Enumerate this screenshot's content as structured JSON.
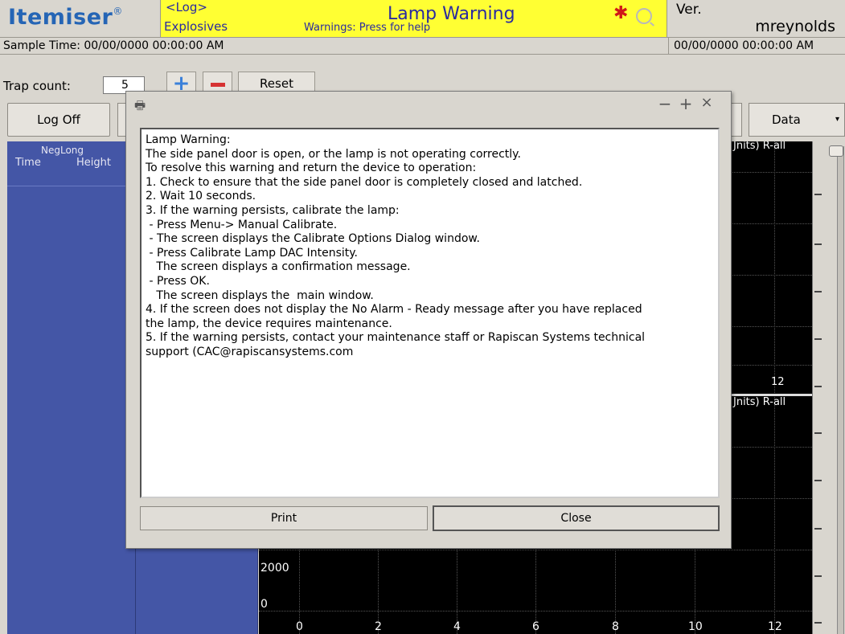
{
  "header": {
    "logo_text": "Itemiser",
    "logo_mark": "®",
    "banner_log": "<Log>",
    "banner_category": "Explosives",
    "banner_title": "Lamp Warning",
    "banner_hint": "Warnings: Press for help",
    "alarm_icon": "asterisk-icon",
    "ver_label": "Ver.",
    "username": "mreynolds",
    "colors": {
      "banner_bg": "#ffff33",
      "banner_text": "#2a2aa0",
      "logo": "#2565b5",
      "alarm": "#d01818",
      "panel": "#4456a6"
    }
  },
  "status": {
    "sample_time": "Sample Time: 00/00/0000  00:00:00 AM",
    "right_time": "00/00/0000  00:00:00 AM"
  },
  "controls": {
    "trap_label": "Trap count:",
    "trap_value": "5",
    "plus_label": "+",
    "reset_label": "Reset",
    "logoff_label": "Log Off",
    "data_label": "Data",
    "data_dropdown": "▾"
  },
  "table": {
    "group_header": "NegLong",
    "col_time": "Time",
    "col_height": "Height"
  },
  "chart": {
    "top_label": "Jnits) R-all",
    "bottom_label": "Jnits) R-all",
    "top_value": "12",
    "y_labels": [
      "2000",
      "0"
    ],
    "x_labels": [
      "0",
      "2",
      "4",
      "6",
      "8",
      "10",
      "12"
    ]
  },
  "dialog": {
    "icon": "printer-icon",
    "min_symbol": "−",
    "max_symbol": "+",
    "close_symbol": "×",
    "lines": [
      "Lamp Warning:",
      "The side panel door is open, or the lamp is not operating correctly.",
      "To resolve this warning and return the device to operation:",
      "1. Check to ensure that the side panel door is completely closed and latched.",
      "2. Wait 10 seconds.",
      "3. If the warning persists, calibrate the lamp:",
      " - Press Menu-> Manual Calibrate.",
      " - The screen displays the Calibrate Options Dialog window.",
      " - Press Calibrate Lamp DAC Intensity.",
      "   The screen displays a confirmation message.",
      " - Press OK.",
      "   The screen displays the  main window.",
      "4. If the screen does not display the No Alarm - Ready message after you have replaced",
      "the lamp, the device requires maintenance.",
      "5. If the warning persists, contact your maintenance staff or Rapiscan Systems technical",
      "support (CAC@rapiscansystems.com"
    ],
    "print_label": "Print",
    "close_label": "Close"
  }
}
